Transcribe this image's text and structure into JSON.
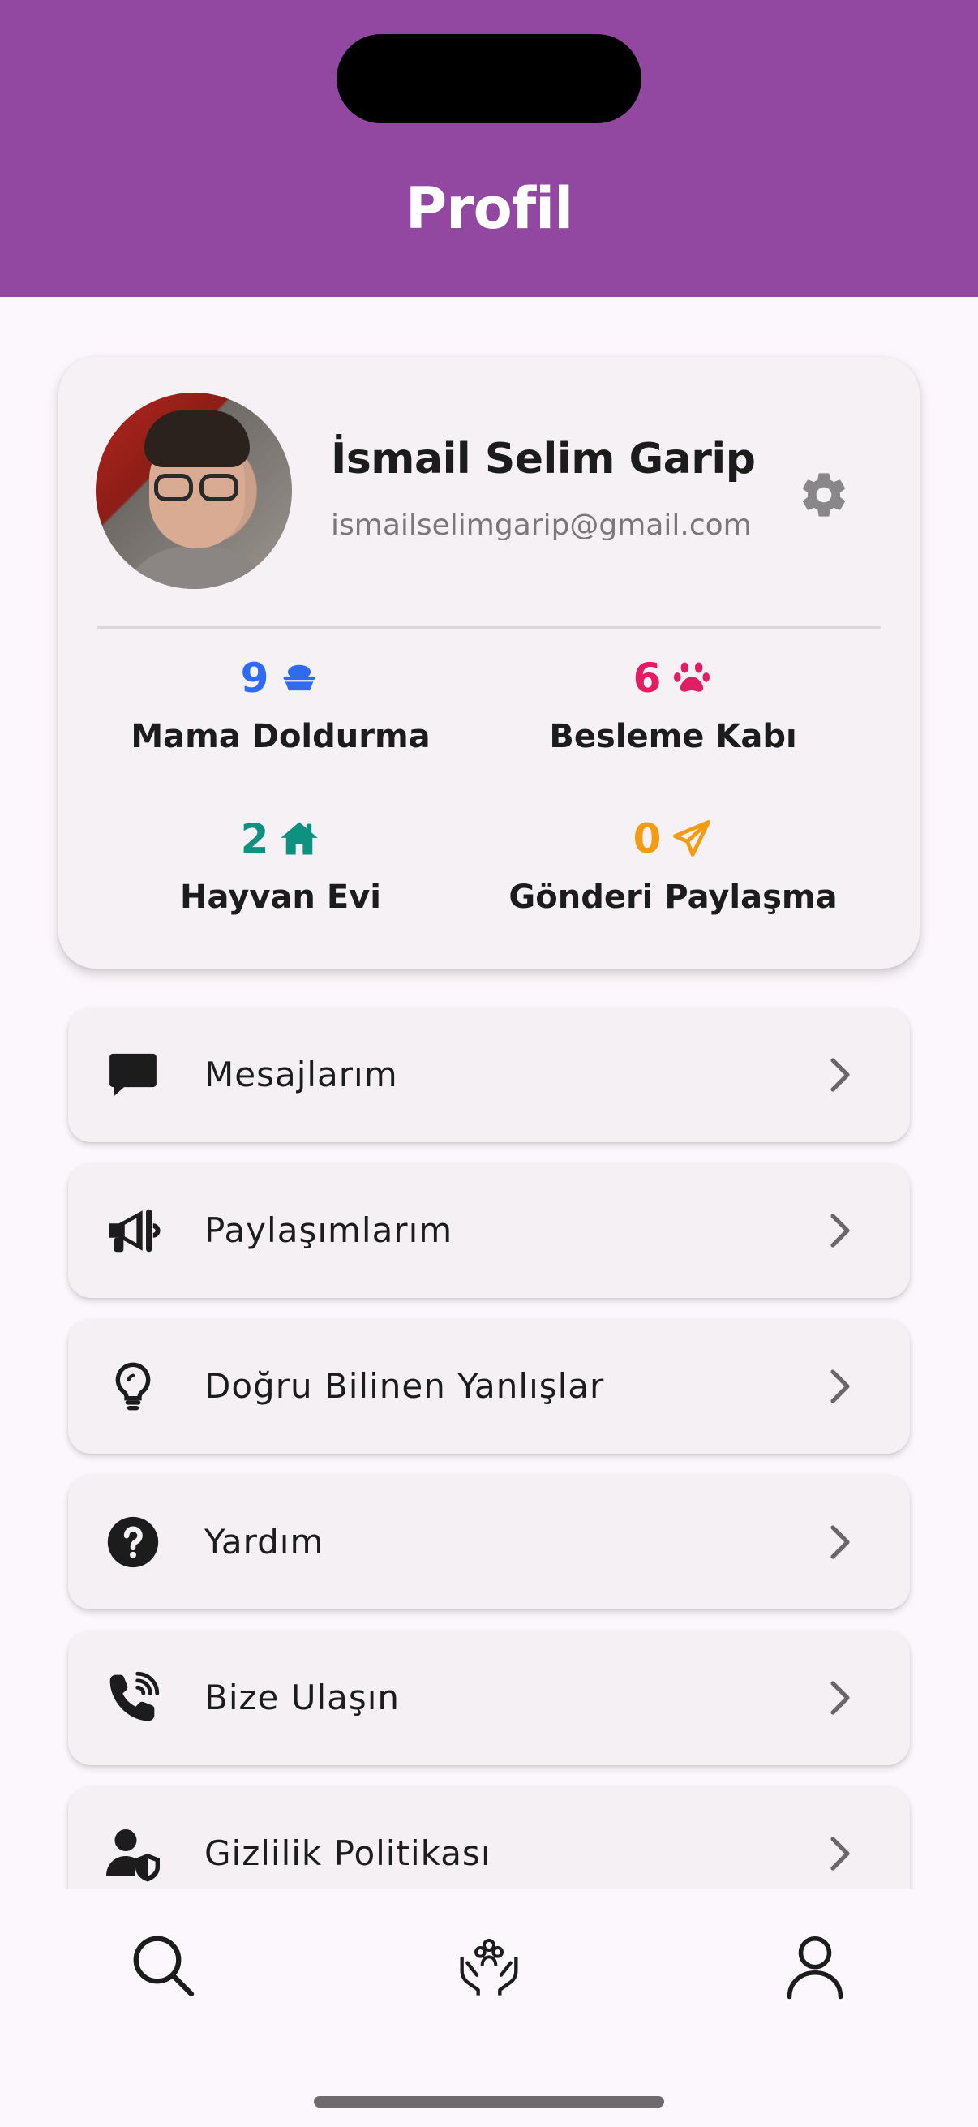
{
  "header": {
    "title": "Profil"
  },
  "profile": {
    "name": "İsmail Selim Garip",
    "email": "ismailselimgarip@gmail.com",
    "settings_icon": "gear-icon"
  },
  "stats": [
    {
      "count": "9",
      "label": "Mama Doldurma",
      "icon": "food-bowl-icon",
      "color": "#2f6bf0"
    },
    {
      "count": "6",
      "label": "Besleme Kabı",
      "icon": "paw-icon",
      "color": "#e21d63"
    },
    {
      "count": "2",
      "label": "Hayvan Evi",
      "icon": "house-icon",
      "color": "#0f9182"
    },
    {
      "count": "0",
      "label": "Gönderi Paylaşma",
      "icon": "paper-plane-icon",
      "color": "#f59b12"
    }
  ],
  "menu": [
    {
      "label": "Mesajlarım",
      "icon": "message-icon"
    },
    {
      "label": "Paylaşımlarım",
      "icon": "megaphone-icon"
    },
    {
      "label": "Doğru Bilinen Yanlışlar",
      "icon": "lightbulb-icon"
    },
    {
      "label": "Yardım",
      "icon": "question-circle-icon"
    },
    {
      "label": "Bize Ulaşın",
      "icon": "phone-call-icon"
    },
    {
      "label": "Gizlilik Politikası",
      "icon": "user-shield-icon"
    }
  ],
  "bottom_nav": [
    {
      "icon": "search-icon"
    },
    {
      "icon": "hands-care-icon"
    },
    {
      "icon": "person-icon"
    }
  ],
  "colors": {
    "header": "#9247a1",
    "background": "#fcf7fc",
    "card": "#f5f1f5"
  }
}
